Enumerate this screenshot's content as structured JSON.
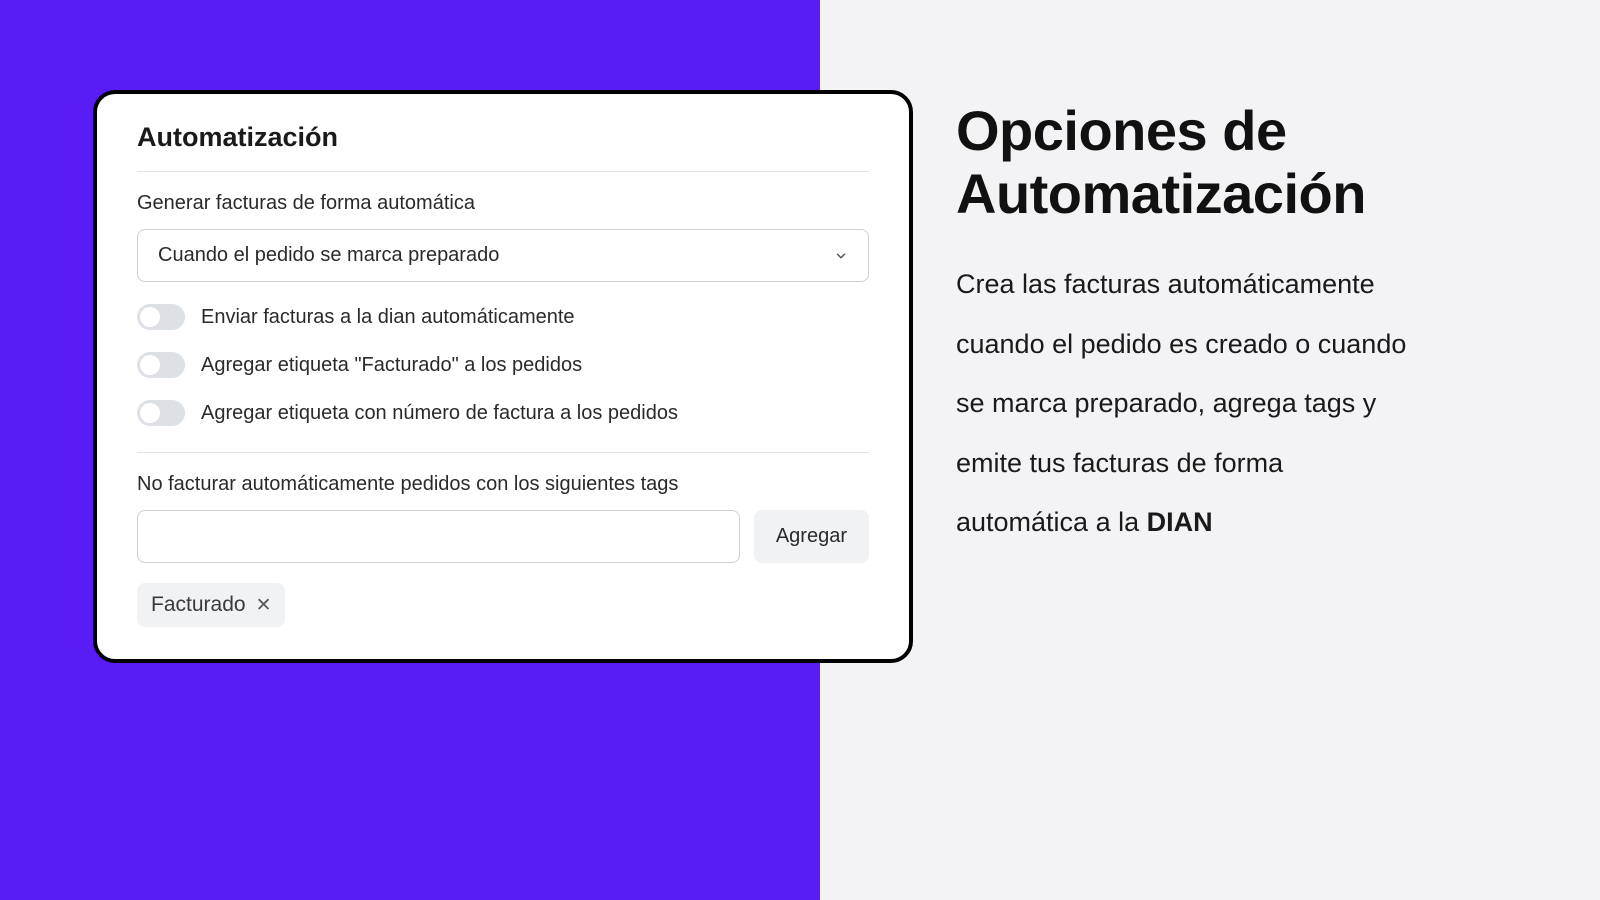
{
  "card": {
    "title": "Automatización",
    "generate_label": "Generar facturas de forma automática",
    "select_value": "Cuando el pedido se marca preparado",
    "toggles": [
      {
        "label": "Enviar facturas a la dian automáticamente"
      },
      {
        "label": "Agregar etiqueta \"Facturado\" a los pedidos"
      },
      {
        "label": "Agregar etiqueta con número de factura a los pedidos"
      }
    ],
    "exclude_label": "No facturar automáticamente pedidos con los siguientes tags",
    "add_button": "Agregar",
    "tag": "Facturado"
  },
  "right": {
    "heading": "Opciones de Automatización",
    "desc_prefix": "Crea las facturas automáticamente cuando el pedido es creado o cuando se marca preparado, agrega tags y emite tus facturas de forma automática a la ",
    "desc_bold": "DIAN"
  }
}
